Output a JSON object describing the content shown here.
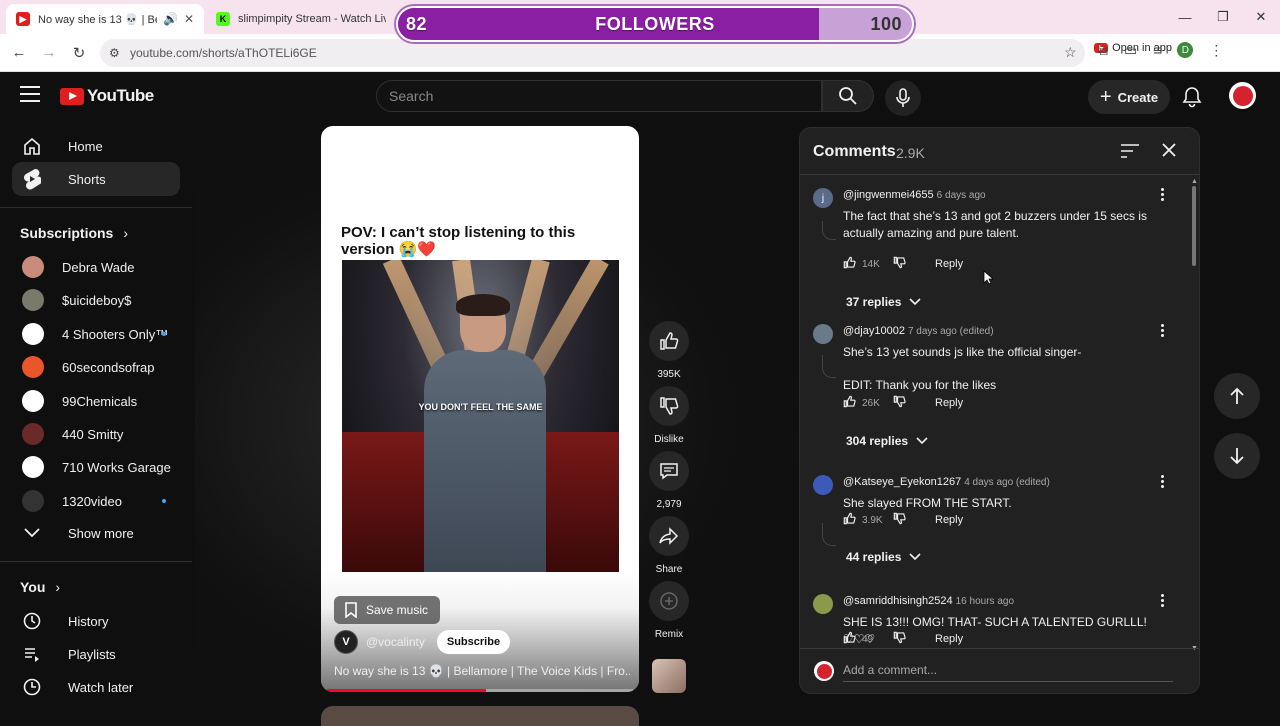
{
  "browser": {
    "tabs": [
      {
        "title": "No way she is 13 💀 | Bellar",
        "active": true
      },
      {
        "title": "slimpimpity Stream - Watch Liv",
        "active": false
      }
    ],
    "url": "youtube.com/shorts/aThOTELi6GE",
    "open_in_app": "Open in app",
    "profile_initial": "D"
  },
  "overlay": {
    "current": "82",
    "label": "FOLLOWERS",
    "goal": "100",
    "progress": 0.82
  },
  "header": {
    "logo_text": "YouTube",
    "search_placeholder": "Search",
    "create_label": "Create"
  },
  "sidebar": {
    "items": [
      {
        "label": "Home",
        "icon": "home-icon"
      },
      {
        "label": "Shorts",
        "icon": "shorts-icon",
        "active": true
      }
    ],
    "subscriptions_title": "Subscriptions",
    "subscriptions": [
      {
        "name": "Debra Wade",
        "color": "#c98c7a",
        "dot": false
      },
      {
        "name": "$uicideboy$",
        "color": "#7a7a6a",
        "dot": false
      },
      {
        "name": "4 Shooters Only™",
        "color": "#ffffff",
        "dot": true
      },
      {
        "name": "60secondsofrap",
        "color": "#e8562a",
        "dot": false
      },
      {
        "name": "99Chemicals",
        "color": "#ffffff",
        "dot": false
      },
      {
        "name": "440 Smitty",
        "color": "#6a2a2a",
        "dot": false
      },
      {
        "name": "710 Works Garage",
        "color": "#ffffff",
        "dot": false
      },
      {
        "name": "1320video",
        "color": "#333333",
        "dot": true
      }
    ],
    "show_more": "Show more",
    "you_title": "You",
    "you_items": [
      {
        "label": "History",
        "icon": "history-icon"
      },
      {
        "label": "Playlists",
        "icon": "playlists-icon"
      },
      {
        "label": "Watch later",
        "icon": "watch-later-icon"
      }
    ]
  },
  "video": {
    "overlay_text": "POV: I can’t stop listening to this version 😭❤️",
    "caption": "YOU DON'T FEEL THE SAME",
    "save_music": "Save music",
    "channel_handle": "@vocalinty",
    "channel_initial": "V",
    "subscribe": "Subscribe",
    "title": "No way she is 13 💀 | Bellamore | The Voice Kids | Fro...",
    "progress": 0.52
  },
  "actions": {
    "like_count": "395K",
    "dislike_label": "Dislike",
    "comment_count": "2,979",
    "share_label": "Share",
    "remix_label": "Remix"
  },
  "comments": {
    "title": "Comments",
    "count": "2.9K",
    "add_placeholder": "Add a comment...",
    "items": [
      {
        "user": "@jingwenmei4655",
        "time": "6 days ago",
        "text": "The fact that she’s 13 and got 2 buzzers under 15 secs is actually amazing and pure talent.",
        "likes": "14K",
        "reply": "Reply",
        "replies": "37 replies",
        "avatar_letter": "j",
        "avatar_color": "#5a6b8a"
      },
      {
        "user": "@djay10002",
        "time": "7 days ago (edited)",
        "text": "She’s 13 yet sounds js like the official singer-",
        "text2": "EDIT: Thank you for the likes",
        "likes": "26K",
        "reply": "Reply",
        "replies": "304 replies",
        "avatar_letter": "",
        "avatar_color": "#6a7a8a"
      },
      {
        "user": "@Katseye_Eyekon1267",
        "time": "4 days ago (edited)",
        "text": "She slayed FROM THE START.",
        "likes": "3.9K",
        "reply": "Reply",
        "replies": "44 replies",
        "avatar_letter": "",
        "avatar_color": "#3d5ab8"
      },
      {
        "user": "@samriddhisingh2524",
        "time": "16 hours ago",
        "text": "SHE IS 13!!! OMG! THAT- SUCH A TALENTED GURLLL!♡♡♡",
        "likes": "49",
        "reply": "Reply",
        "replies": "",
        "avatar_letter": "",
        "avatar_color": "#8a9a4a"
      }
    ]
  },
  "colors": {
    "accent": "#ff0033",
    "overlay_fill": "#8b1fa3",
    "overlay_bg": "#c8a2d6"
  }
}
